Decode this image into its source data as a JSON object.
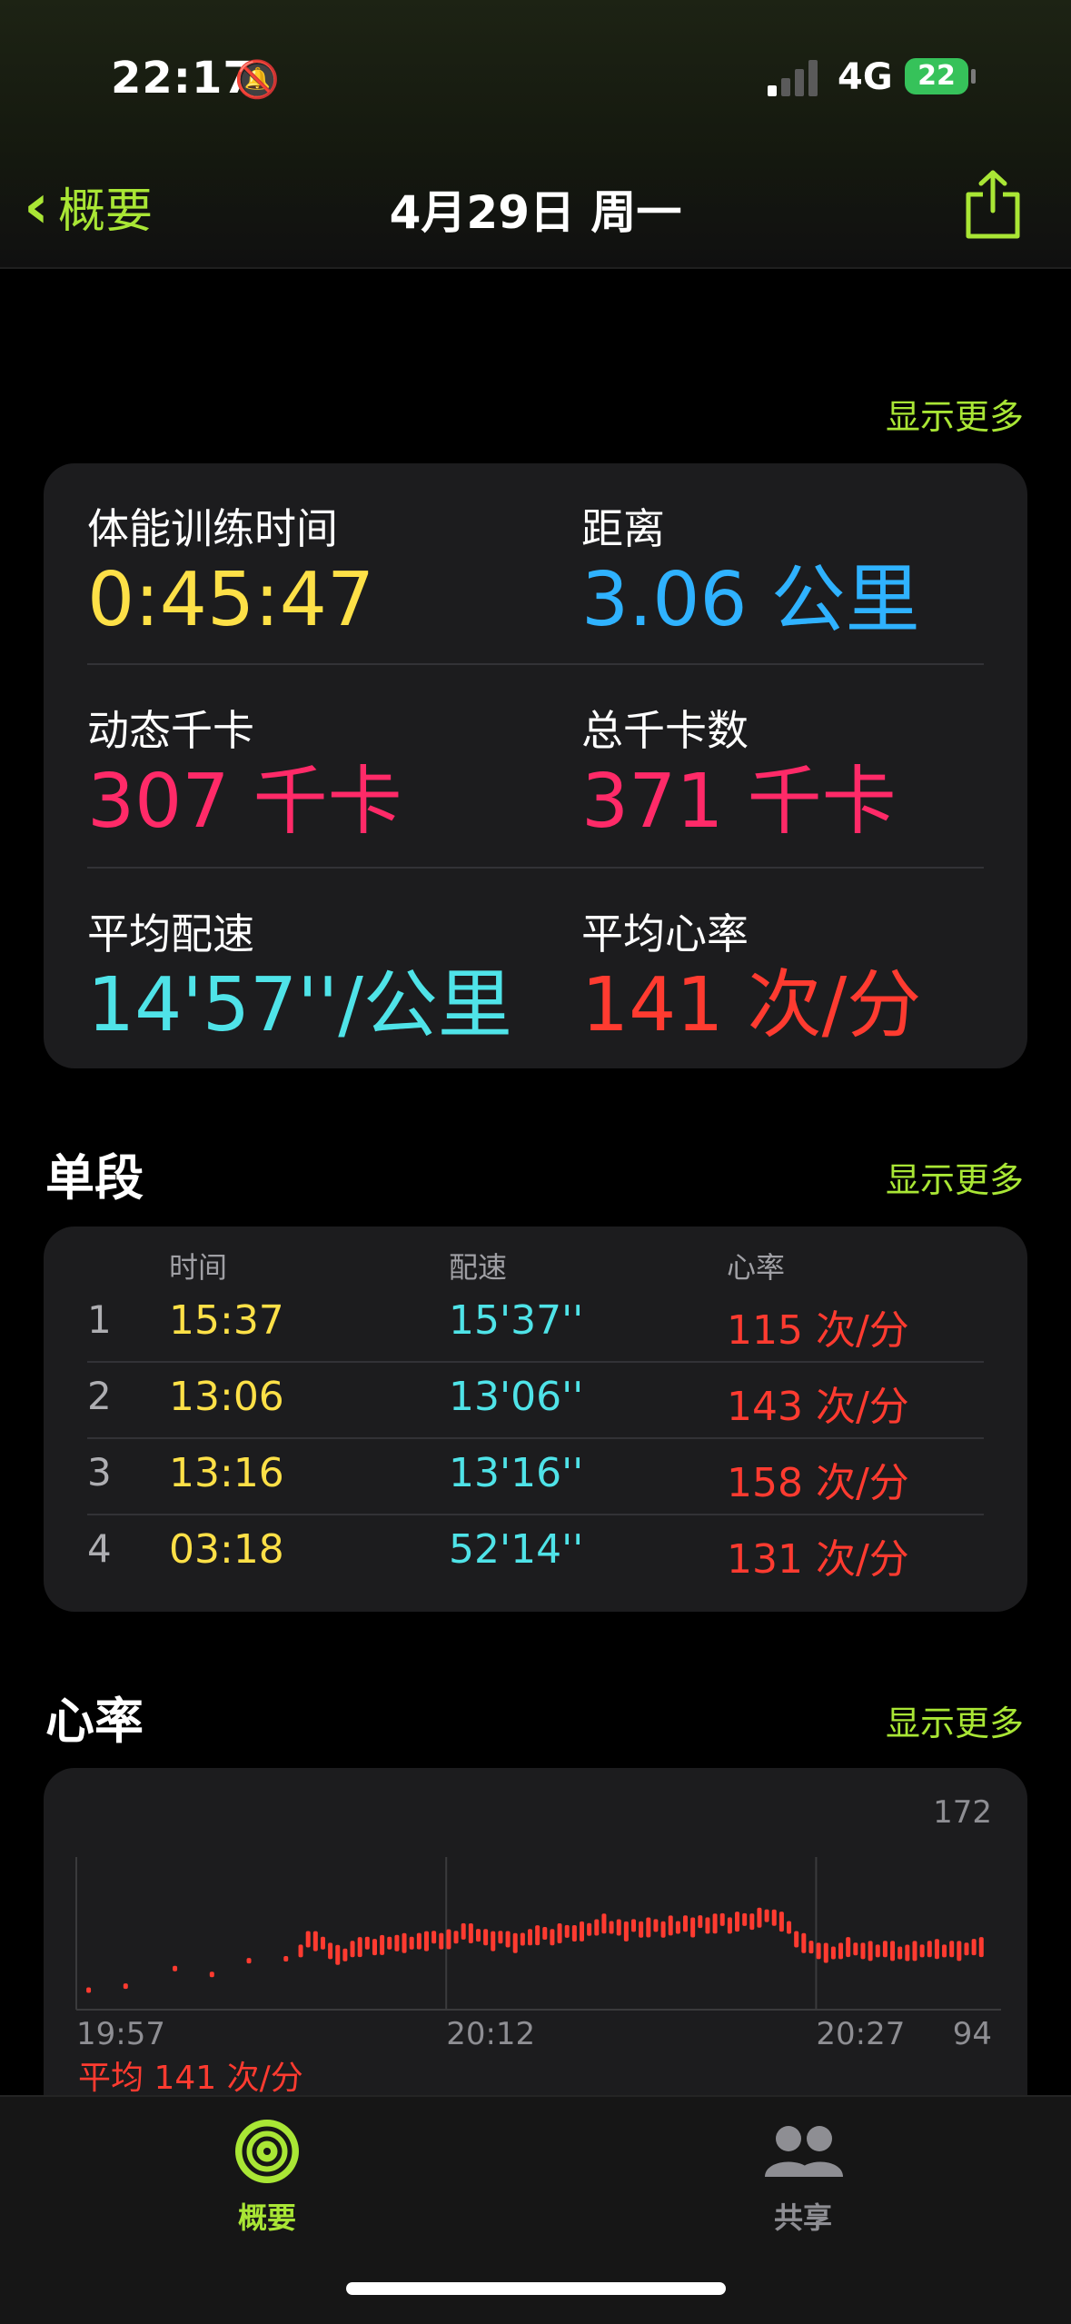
{
  "status": {
    "time": "22:17",
    "network": "4G",
    "battery": "22"
  },
  "nav": {
    "back_label": "概要",
    "title": "4月29日 周一"
  },
  "summary": {
    "show_more": "显示更多",
    "metrics": [
      {
        "label": "体能训练时间",
        "value": "0:45:47"
      },
      {
        "label": "距离",
        "value": "3.06 公里"
      },
      {
        "label": "动态千卡",
        "value": "307 千卡"
      },
      {
        "label": "总千卡数",
        "value": "371 千卡"
      },
      {
        "label": "平均配速",
        "value": "14'57''/公里"
      },
      {
        "label": "平均心率",
        "value": "141 次/分"
      }
    ]
  },
  "splits": {
    "title": "单段",
    "show_more": "显示更多",
    "headers": [
      "时间",
      "配速",
      "心率"
    ],
    "rows": [
      {
        "idx": "1",
        "time": "15:37",
        "pace": "15'37''",
        "hr": "115 次/分"
      },
      {
        "idx": "2",
        "time": "13:06",
        "pace": "13'06''",
        "hr": "143 次/分"
      },
      {
        "idx": "3",
        "time": "13:16",
        "pace": "13'16''",
        "hr": "158 次/分"
      },
      {
        "idx": "4",
        "time": "03:18",
        "pace": "52'14''",
        "hr": "131 次/分"
      }
    ]
  },
  "heart": {
    "title": "心率",
    "show_more": "显示更多",
    "avg_label": "平均 141 次/分"
  },
  "chart_data": {
    "type": "scatter",
    "title": "",
    "xlabel": "",
    "ylabel": "",
    "x_tick_labels": [
      "19:57",
      "20:12",
      "20:27"
    ],
    "y_tick_labels": [
      "94",
      "172"
    ],
    "ylim": [
      94,
      172
    ],
    "series": [
      {
        "color": "#ff3b30",
        "x": [
          0.5,
          2,
          4,
          5.5,
          7,
          8.5,
          9.1,
          9.4,
          9.7,
          10,
          10.3,
          10.6,
          10.9,
          11.2,
          11.5,
          11.8,
          12.1,
          12.4,
          12.7,
          13,
          13.3,
          13.6,
          13.9,
          14.2,
          14.5,
          14.8,
          15.1,
          15.4,
          15.7,
          16,
          16.3,
          16.6,
          16.9,
          17.2,
          17.5,
          17.8,
          18.1,
          18.4,
          18.7,
          19,
          19.3,
          19.6,
          19.9,
          20.2,
          20.5,
          20.8,
          21.1,
          21.4,
          21.7,
          22,
          22.3,
          22.6,
          22.9,
          23.2,
          23.5,
          23.8,
          24.1,
          24.4,
          24.7,
          25,
          25.3,
          25.6,
          25.9,
          26.2,
          26.5,
          26.8,
          27.1,
          27.4,
          27.7,
          28,
          28.3,
          28.6,
          28.9,
          29.2,
          29.5,
          29.8,
          30.1,
          30.4,
          30.7,
          31,
          31.3,
          31.6,
          31.9,
          32.2,
          32.5,
          32.8,
          33.1,
          33.4,
          33.7,
          34,
          34.3,
          34.6,
          34.9,
          35.2,
          35.5,
          35.8,
          36.1,
          36.4,
          36.7
        ],
        "y": [
          104,
          106,
          115,
          112,
          119,
          120,
          124,
          130,
          129,
          128,
          124,
          122,
          122,
          125,
          126,
          128,
          126,
          127,
          128,
          128,
          128,
          128,
          129,
          129,
          131,
          129,
          130,
          131,
          134,
          133,
          132,
          131,
          129,
          131,
          130,
          128,
          130,
          131,
          132,
          133,
          131,
          133,
          134,
          133,
          134,
          135,
          136,
          138,
          136,
          136,
          134,
          137,
          135,
          136,
          137,
          135,
          137,
          136,
          138,
          136,
          139,
          137,
          138,
          140,
          137,
          139,
          140,
          139,
          141,
          142,
          141,
          139,
          136,
          130,
          128,
          126,
          124,
          123,
          123,
          124,
          126,
          125,
          124,
          124,
          124,
          125,
          124,
          123,
          123,
          124,
          124,
          125,
          125,
          124,
          125,
          124,
          125,
          126,
          126
        ]
      }
    ]
  },
  "tabs": [
    {
      "label": "概要"
    },
    {
      "label": "共享"
    }
  ],
  "colors": {
    "accent": "#a9e635",
    "time": "#fde047",
    "distance": "#2fb2ff",
    "calories": "#ff2a68",
    "pace": "#4fe3e8",
    "heart": "#ff3b30"
  }
}
